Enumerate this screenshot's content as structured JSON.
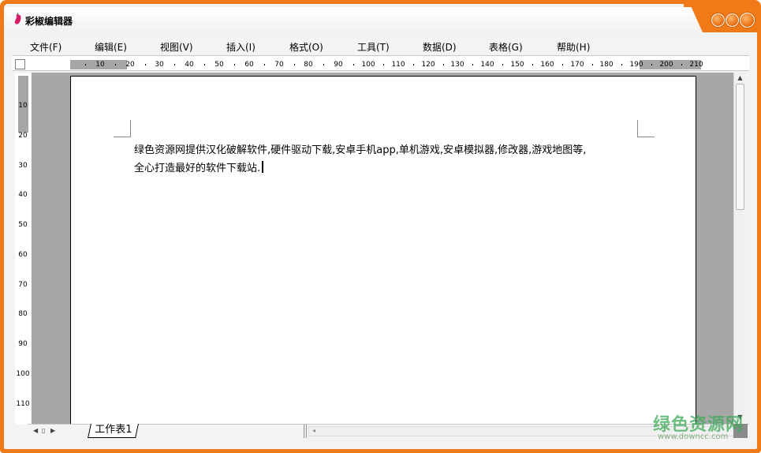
{
  "window": {
    "title": "彩椒编辑器",
    "accent_color": "#f07a17",
    "icon": "pepper-icon",
    "controls": {
      "minimize_icon": "minimize-circle-icon",
      "maximize_icon": "maximize-circle-icon",
      "close_icon": "close-circle-icon"
    }
  },
  "menubar": {
    "items": [
      {
        "label": "文件(F)"
      },
      {
        "label": "编辑(E)"
      },
      {
        "label": "视图(V)"
      },
      {
        "label": "插入(I)"
      },
      {
        "label": "格式(O)"
      },
      {
        "label": "工具(T)"
      },
      {
        "label": "数据(D)"
      },
      {
        "label": "表格(G)"
      },
      {
        "label": "帮助(H)"
      }
    ]
  },
  "rulers": {
    "horizontal_labels": [
      "10",
      "20",
      "30",
      "40",
      "50",
      "60",
      "70",
      "80",
      "90",
      "100",
      "110",
      "120",
      "130",
      "140",
      "150",
      "160",
      "170",
      "180",
      "190",
      "200",
      "210"
    ],
    "vertical_labels": [
      "10",
      "20",
      "30",
      "40",
      "50",
      "60",
      "70",
      "80",
      "90",
      "100",
      "110"
    ]
  },
  "document": {
    "lines": [
      "绿色资源网提供汉化破解软件,硬件驱动下载,安卓手机app,单机游戏,安卓模拟器,修改器,游戏地图等,",
      "全心打造最好的软件下载站."
    ]
  },
  "sheets": {
    "active_tab": "工作表1"
  },
  "watermark": {
    "text": "绿色资源网",
    "url": "www.downcc.com"
  }
}
